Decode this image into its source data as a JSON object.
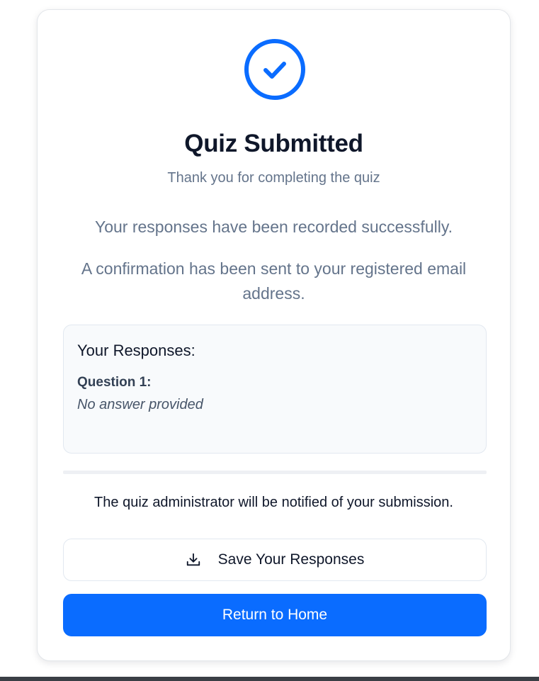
{
  "confirmation": {
    "title": "Quiz Submitted",
    "subtitle": "Thank you for completing the quiz",
    "message_recorded": "Your responses have been recorded successfully.",
    "message_email": "A confirmation has been sent to your registered email address."
  },
  "responses": {
    "heading": "Your Responses:",
    "items": [
      {
        "question": "Question 1:",
        "answer": "No answer provided"
      }
    ]
  },
  "notice": "The quiz administrator will be notified of your submission.",
  "actions": {
    "save_label": "Save Your Responses",
    "home_label": "Return to Home"
  },
  "icons": {
    "status": "check-circle-icon",
    "save": "download-icon"
  },
  "colors": {
    "accent": "#0a6cff",
    "title": "#0f172a",
    "muted": "#64748b"
  }
}
